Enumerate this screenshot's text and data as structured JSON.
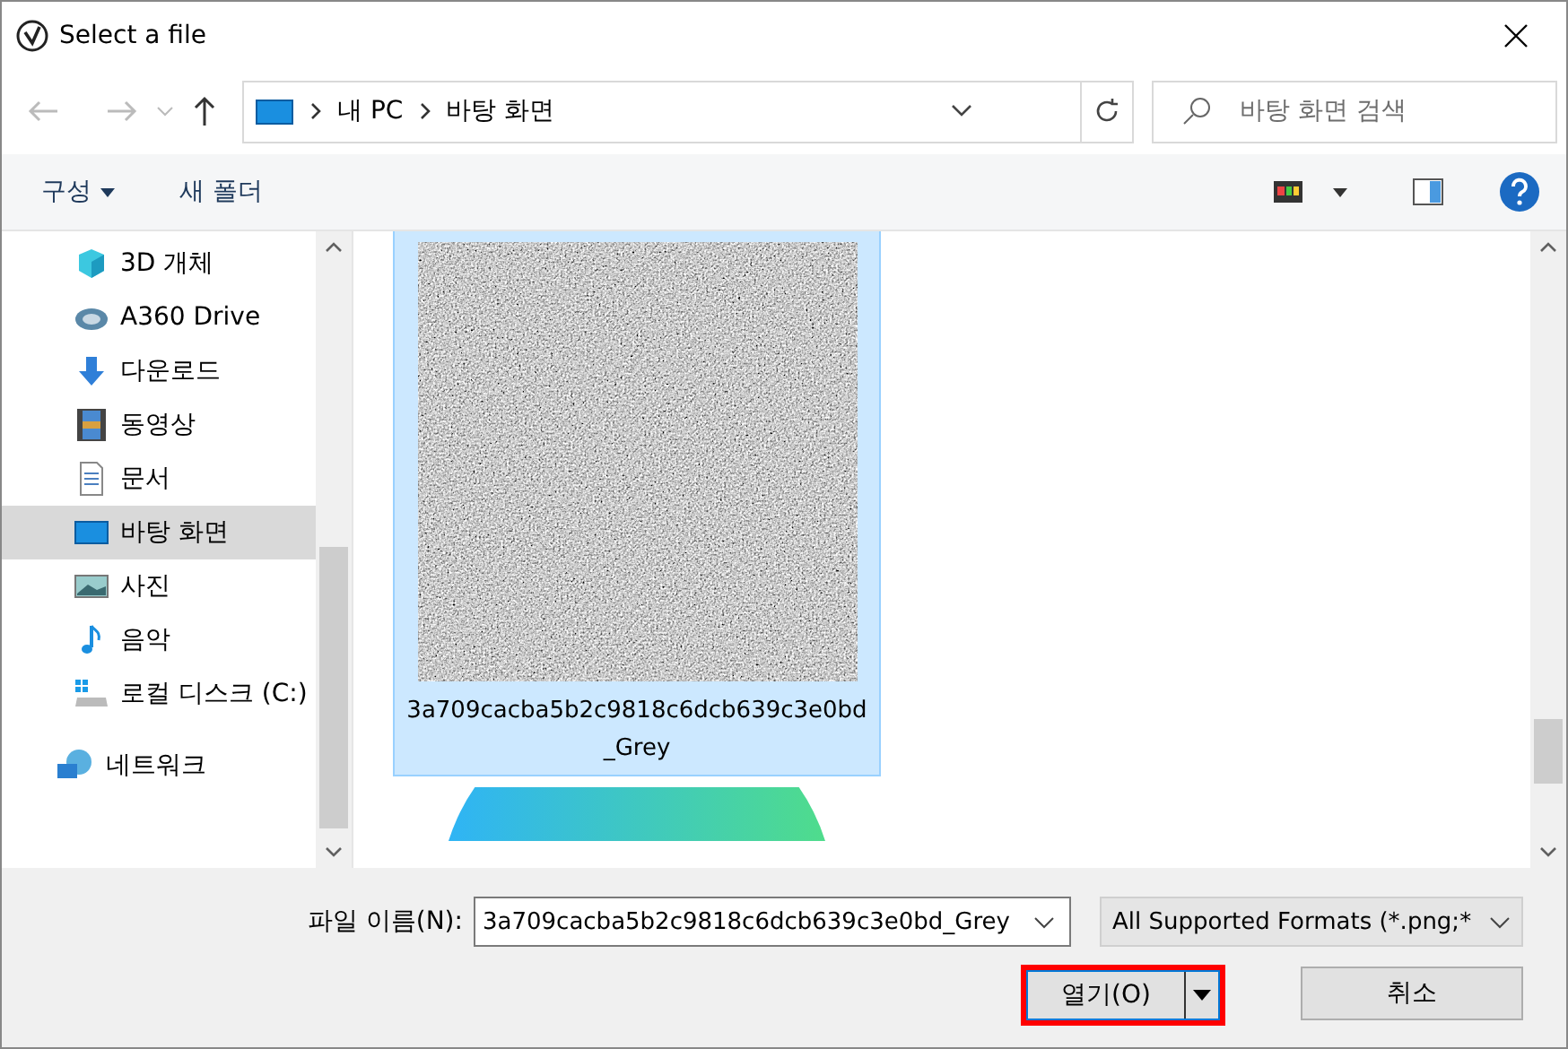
{
  "window": {
    "title": "Select a file"
  },
  "address": {
    "path": [
      "내 PC",
      "바탕 화면"
    ]
  },
  "search": {
    "placeholder": "바탕 화면 검색"
  },
  "toolbar": {
    "organize": "구성",
    "new_folder": "새 폴더"
  },
  "sidebar": {
    "items": [
      {
        "label": "3D 개체",
        "kind": "cube",
        "selected": false
      },
      {
        "label": "A360 Drive",
        "kind": "cloud",
        "selected": false
      },
      {
        "label": "다운로드",
        "kind": "download",
        "selected": false
      },
      {
        "label": "동영상",
        "kind": "film",
        "selected": false
      },
      {
        "label": "문서",
        "kind": "document",
        "selected": false
      },
      {
        "label": "바탕 화면",
        "kind": "desktop",
        "selected": true
      },
      {
        "label": "사진",
        "kind": "picture",
        "selected": false
      },
      {
        "label": "음악",
        "kind": "music",
        "selected": false
      },
      {
        "label": "로컬 디스크 (C:)",
        "kind": "disk",
        "selected": false
      }
    ],
    "network": {
      "label": "네트워크"
    }
  },
  "files": [
    {
      "name": "3a709cacba5b2c9818c6dcb639c3e0bd_Grey",
      "kind": "texture",
      "selected": true
    },
    {
      "kind": "gradient",
      "selected": false
    }
  ],
  "footer": {
    "filename_label": "파일 이름(N):",
    "filename": "3a709cacba5b2c9818c6dcb639c3e0bd_Grey",
    "filter": "All Supported Formats (*.png;*",
    "open": "열기(O)",
    "open_highlighted": true,
    "cancel": "취소"
  }
}
